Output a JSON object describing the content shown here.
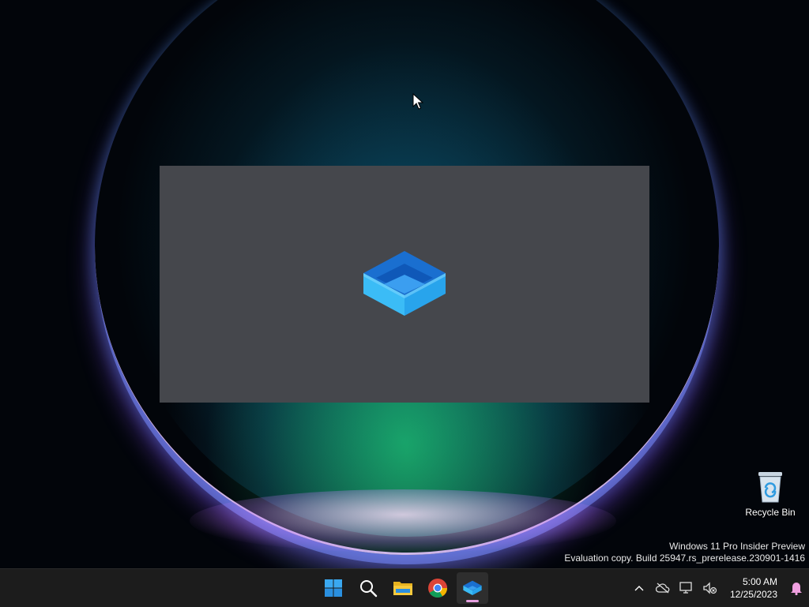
{
  "desktop": {
    "icons": [
      {
        "label": "Recycle Bin",
        "icon": "recycle-bin-icon"
      }
    ]
  },
  "splash": {
    "icon": "app-box-logo-icon"
  },
  "watermark": {
    "line1": "Windows 11 Pro Insider Preview",
    "line2": "Evaluation copy. Build 25947.rs_prerelease.230901-1416"
  },
  "taskbar": {
    "pinned": [
      {
        "name": "start",
        "icon": "windows-logo-icon"
      },
      {
        "name": "search",
        "icon": "search-icon"
      },
      {
        "name": "file-explorer",
        "icon": "folder-icon"
      },
      {
        "name": "chrome",
        "icon": "chrome-icon"
      },
      {
        "name": "running-app",
        "icon": "app-box-logo-icon",
        "active": true
      }
    ],
    "tray": {
      "icons": [
        "chevron-up-icon",
        "cloud-offline-icon",
        "network-icon",
        "volume-muted-icon",
        "notification-bell-icon"
      ],
      "time": "5:00 AM",
      "date": "12/25/2023"
    }
  },
  "colors": {
    "taskbar_bg": "#1c1c1c",
    "splash_bg": "#45474c",
    "accent_blue": "#3aa8f0"
  }
}
